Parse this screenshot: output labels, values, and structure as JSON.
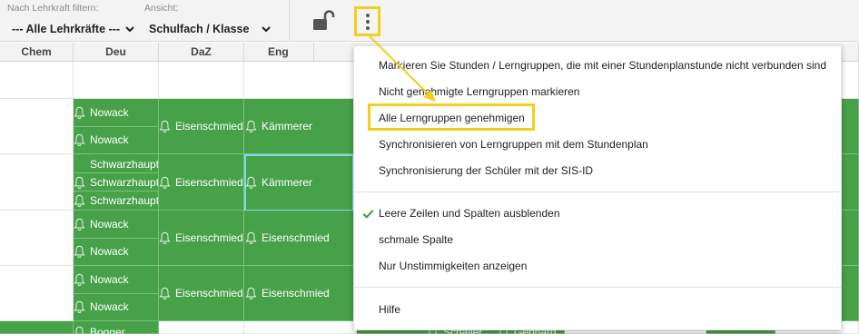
{
  "toolbar": {
    "teacher_filter_label": "Nach Lehrkraft filtern:",
    "teacher_filter_value": "--- Alle Lehrkräfte ---",
    "view_label": "Ansicht:",
    "view_value": "Schulfach / Klasse",
    "lock_icon": "unlocked-padlock-icon",
    "more_icon": "vertical-dots-icon"
  },
  "grid": {
    "headers": [
      "Chem",
      "Deu",
      "DaZ",
      "Eng"
    ],
    "rows": [
      {
        "deu": [
          "Nowack",
          "Nowack"
        ],
        "daz": "Eisenschmied",
        "eng": "Kämmerer"
      },
      {
        "deu": [
          "Schwarzhaupt",
          "Schwarzhaupt",
          "Schwarzhaupt"
        ],
        "daz": "Eisenschmied",
        "eng": "Kämmerer"
      },
      {
        "deu": [
          "Nowack",
          "Nowack"
        ],
        "daz": "Eisenschmied",
        "eng": "Eisenschmied"
      },
      {
        "deu": [
          "Nowack",
          "Nowack"
        ],
        "daz": "Eisenschmied",
        "eng": "Eisenschmied"
      },
      {
        "deu": [
          "Bogger"
        ],
        "extra": [
          "Schaller",
          "Gebhard"
        ]
      }
    ],
    "bell_icon": "bell-icon",
    "accent_green": "#47a148"
  },
  "menu": {
    "items": [
      "Markieren Sie Stunden / Lerngruppen, die mit einer Stundenplanstunde nicht verbunden sind",
      "Nicht genehmigte Lerngruppen markieren",
      "Alle Lerngruppen genehmigen",
      "Synchronisieren von Lerngruppen mit dem Stundenplan",
      "Synchronisierung der Schüler mit der SIS-ID",
      "Leere Zeilen und Spalten ausblenden",
      "schmale Spalte",
      "Nur Unstimmigkeiten anzeigen",
      "Hilfe"
    ],
    "checked_item_icon": "checkmark-icon",
    "highlight_color": "#f2cf1d"
  }
}
